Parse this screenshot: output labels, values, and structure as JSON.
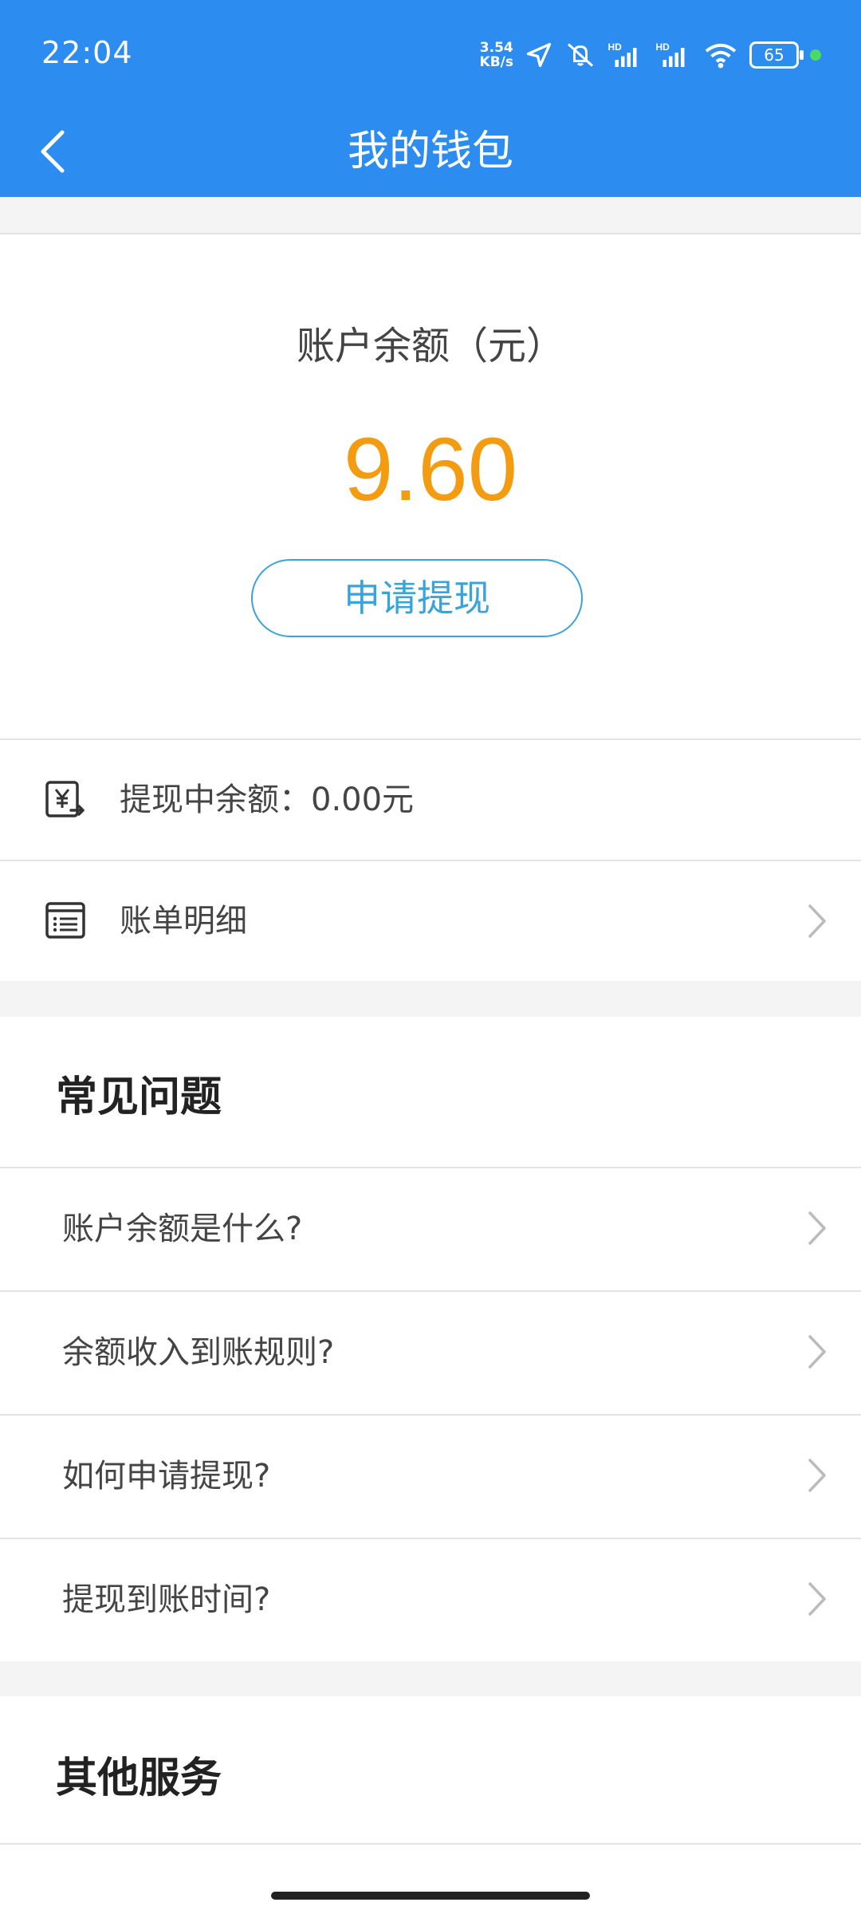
{
  "status_bar": {
    "time": "22:04",
    "net_speed_value": "3.54",
    "net_speed_unit": "KB/s",
    "battery": "65"
  },
  "nav": {
    "title": "我的钱包",
    "back_icon": "chevron-left-icon"
  },
  "balance": {
    "label": "账户余额（元）",
    "amount": "9.60",
    "amount_color": "#f39c12",
    "withdraw_button": "申请提现",
    "accent_color": "#3aa3d8"
  },
  "rows": {
    "pending": {
      "label": "提现中余额：0.00元",
      "icon": "yuan-transfer-icon"
    },
    "bill": {
      "label": "账单明细",
      "icon": "list-icon"
    }
  },
  "faq": {
    "title": "常见问题",
    "items": [
      {
        "label": "账户余额是什么?"
      },
      {
        "label": "余额收入到账规则?"
      },
      {
        "label": "如何申请提现?"
      },
      {
        "label": "提现到账时间?"
      }
    ]
  },
  "other": {
    "title": "其他服务"
  },
  "colors": {
    "header": "#2d8cf0",
    "background": "#f4f4f4"
  }
}
